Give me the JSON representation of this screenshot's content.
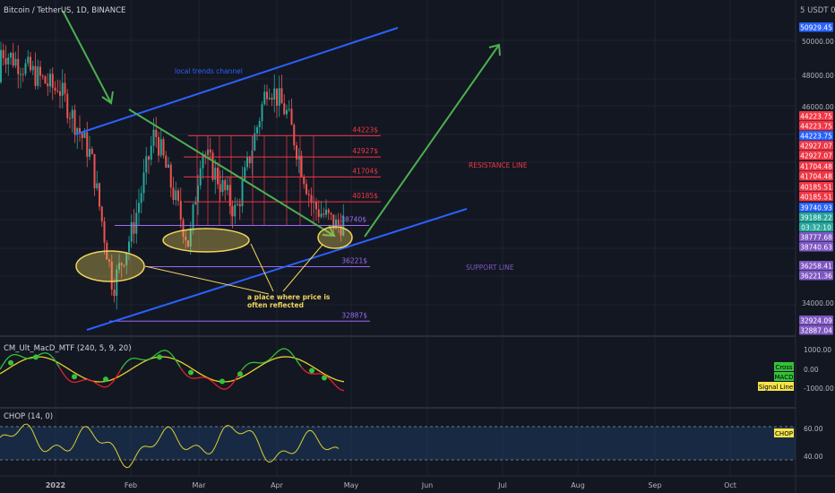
{
  "header": {
    "title": "Bitcoin / TetherUS, 1D, BINANCE",
    "currency": "5 USDT 0"
  },
  "panels": {
    "macd": {
      "label": "CM_Ult_MacD_MTF (240, 5, 9, 20)"
    },
    "chop": {
      "label": "CHOP (14, 0)"
    }
  },
  "annotations": {
    "channel": "local trends channel",
    "resistance": "RESISTANCE LINE",
    "support": "SUPPORT LINE",
    "note_line1": "a place where price is",
    "note_line2": "often reflected"
  },
  "levels": [
    {
      "label": "44223$",
      "value": 44223.75,
      "color": "#f23645"
    },
    {
      "label": "42927$",
      "value": 42927.07,
      "color": "#f23645"
    },
    {
      "label": "41704$",
      "value": 41704.48,
      "color": "#f23645"
    },
    {
      "label": "40185$",
      "value": 40185.51,
      "color": "#f23645"
    },
    {
      "label": "38740$",
      "value": 38740.63,
      "color": "#9c6bf2"
    },
    {
      "label": "36221$",
      "value": 36221.36,
      "color": "#9c6bf2"
    },
    {
      "label": "32887$",
      "value": 32887.04,
      "color": "#9c6bf2"
    }
  ],
  "price_axis": {
    "ticks": [
      "50000.00",
      "48000.00",
      "46000.00",
      "34000.00"
    ],
    "badges": [
      {
        "text": "50929.45",
        "color": "#2962ff"
      },
      {
        "text": "44223.75",
        "color": "#f23645"
      },
      {
        "text": "44223.75",
        "color": "#f23645"
      },
      {
        "text": "44223.75",
        "color": "#2962ff"
      },
      {
        "text": "42927.07",
        "color": "#f23645"
      },
      {
        "text": "42927.07",
        "color": "#f23645"
      },
      {
        "text": "41704.48",
        "color": "#f23645"
      },
      {
        "text": "41704.48",
        "color": "#f23645"
      },
      {
        "text": "40185.51",
        "color": "#f23645"
      },
      {
        "text": "40185.51",
        "color": "#f23645"
      },
      {
        "text": "39740.93",
        "color": "#2962ff"
      },
      {
        "text": "39188.22",
        "color": "#26a69a"
      },
      {
        "text": "03:32:10",
        "color": "#26a69a"
      },
      {
        "text": "38777.68",
        "color": "#7e57c2"
      },
      {
        "text": "38740.63",
        "color": "#7e57c2"
      },
      {
        "text": "36258.41",
        "color": "#7e57c2"
      },
      {
        "text": "36221.36",
        "color": "#7e57c2"
      },
      {
        "text": "32924.09",
        "color": "#7e57c2"
      },
      {
        "text": "32887.04",
        "color": "#7e57c2"
      }
    ]
  },
  "macd_axis": {
    "ticks": [
      "1000.00",
      "0.00",
      "-1000.00"
    ],
    "legend": [
      "Cross",
      "MACD",
      "Signal Line"
    ]
  },
  "chop_axis": {
    "ticks": [
      "60.00",
      "40.00"
    ],
    "legend": "CHOP"
  },
  "time_axis": [
    "2022",
    "Feb",
    "Mar",
    "Apr",
    "May",
    "Jun",
    "Jul",
    "Aug",
    "Sep",
    "Oct"
  ],
  "chart_data": {
    "type": "line",
    "title": "Bitcoin / TetherUS, 1D, BINANCE",
    "xlabel": "",
    "ylabel": "",
    "x": [
      "2022-01-01",
      "2022-01-15",
      "2022-01-24",
      "2022-02-01",
      "2022-02-10",
      "2022-02-24",
      "2022-03-01",
      "2022-03-15",
      "2022-03-28",
      "2022-04-05",
      "2022-04-15",
      "2022-04-25",
      "2022-04-29"
    ],
    "series": [
      {
        "values": [
          47500,
          43000,
          35000,
          38500,
          44500,
          37500,
          43500,
          39500,
          47500,
          45500,
          40000,
          38700,
          39188
        ]
      }
    ],
    "ylim": [
      32000,
      52000
    ],
    "grid": true,
    "legend": "none",
    "colors": {
      "up": "#26a69a",
      "down": "#ef5350",
      "channel": "#2962ff",
      "resistance": "#f23645",
      "support": "#7e57c2",
      "arrow": "#4caf50"
    }
  }
}
